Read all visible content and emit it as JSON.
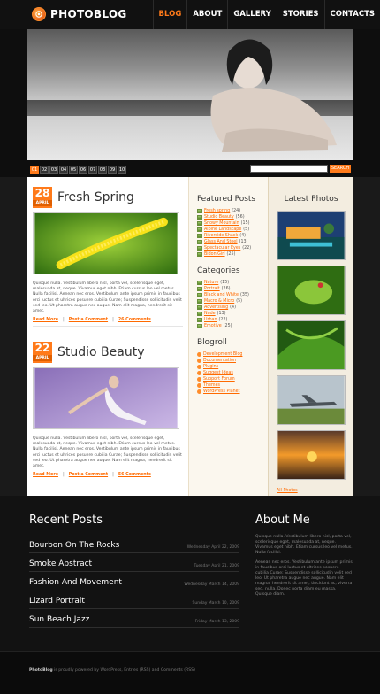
{
  "brand": {
    "name": "PHOTOBLOG"
  },
  "nav": {
    "items": [
      "BLOG",
      "ABOUT",
      "GALLERY",
      "STORIES",
      "CONTACTS"
    ],
    "active_index": 0
  },
  "slider": {
    "pages": [
      "01",
      "02",
      "03",
      "04",
      "05",
      "06",
      "07",
      "08",
      "09",
      "10"
    ],
    "active_page": "01",
    "search_button": "SEARCH"
  },
  "posts": [
    {
      "day": "28",
      "month": "APRIL",
      "title": "Fresh Spring",
      "text": "Quisque nulla. Vestibulum libero nisl, porta vel, scelerisque eget, malesuada at, neque. Vivamus eget nibh. Etiam cursus leo vel metus. Nulla facilisi. Aenean nec eros. Vestibulum ante ipsum primis in faucibus orci luctus et ultrices posuere cubilia Curae; Suspendisse sollicitudin velit sed leo. Ut pharetra augue nec augue. Nam elit magna, hendrerit sit amet.",
      "links": [
        "Read More",
        "Post a Comment",
        "26 Comments"
      ]
    },
    {
      "day": "22",
      "month": "APRIL",
      "title": "Studio Beauty",
      "text": "Quisque nulla. Vestibulum libero nisl, porta vel, scelerisque eget, malesuada at, neque. Vivamus eget nibh. Etiam cursus leo vel metus. Nulla facilisi. Aenean nec eros. Vestibulum ante ipsum primis in faucibus orci luctus et ultrices posuere cubilia Curae; Suspendisse sollicitudin velit sed leo. Ut pharetra augue nec augue. Nam elit magna, hendrerit sit amet.",
      "links": [
        "Read More",
        "Post a Comment",
        "56 Comments"
      ]
    }
  ],
  "featured": {
    "heading": "Featured Posts",
    "items": [
      {
        "label": "Fresh spring",
        "count": "(24)"
      },
      {
        "label": "Studio Beauty",
        "count": "(56)"
      },
      {
        "label": "Snowy Mountain",
        "count": "(15)"
      },
      {
        "label": "Alpine Landscape",
        "count": "(5)"
      },
      {
        "label": "Riverside Shack",
        "count": "(4)"
      },
      {
        "label": "Glass And Steel",
        "count": "(13)"
      },
      {
        "label": "Spectacular Eyes",
        "count": "(22)"
      },
      {
        "label": "Bidon Girl",
        "count": "(25)"
      }
    ]
  },
  "categories": {
    "heading": "Categories",
    "items": [
      {
        "label": "Nature",
        "count": "(15)"
      },
      {
        "label": "Portrait",
        "count": "(26)"
      },
      {
        "label": "Black and White",
        "count": "(35)"
      },
      {
        "label": "Macro & Micro",
        "count": "(5)"
      },
      {
        "label": "Advertising",
        "count": "(4)"
      },
      {
        "label": "Nude",
        "count": "(13)"
      },
      {
        "label": "Urban",
        "count": "(22)"
      },
      {
        "label": "Emotive",
        "count": "(25)"
      }
    ]
  },
  "blogroll": {
    "heading": "Blogroll",
    "items": [
      "Development Blog",
      "Documentation",
      "Plugins",
      "Suggest Ideas",
      "Support Forum",
      "Themes",
      "WordPress Planet"
    ]
  },
  "photos": {
    "heading": "Latest Photos",
    "all_link": "All Photos"
  },
  "recent": {
    "heading": "Recent Posts",
    "items": [
      {
        "title": "Bourbon On The Rocks",
        "date": "Wednesday April 22, 2009"
      },
      {
        "title": "Smoke Abstract",
        "date": "Tuesday April 21, 2009"
      },
      {
        "title": "Fashion And Movement",
        "date": "Wednesday March 14, 2009"
      },
      {
        "title": "Lizard Portrait",
        "date": "Sunday March 10, 2009"
      },
      {
        "title": "Sun Beach Jazz",
        "date": "Friday March 13, 2009"
      }
    ]
  },
  "about": {
    "heading": "About Me",
    "para1": "Quisque nulla. Vestibulum libero nisl, porta vel, scelerisque eget, malesuada at, neque. Vivamus eget nibh. Etiam cursus leo vel metus. Nulla facilisi.",
    "para2": "Aenean nec eros. Vestibulum ante ipsum primis in faucibus orci luctus et ultrices posuere cubilia Curae; Suspendisse sollicitudin velit sed leo. Ut pharetra augue nec augue. Nam elit magna, hendrerit sit amet, tincidunt ac, viverra sed, nulla. Donec porta diam eu massa. Quisque diam."
  },
  "footer": {
    "brand": "PhotoBlog",
    "text": " is proudly powered by WordPress, Entries (RSS) and Comments (RSS)"
  },
  "colors": {
    "accent": "#ff7a1a",
    "dark": "#121212"
  }
}
